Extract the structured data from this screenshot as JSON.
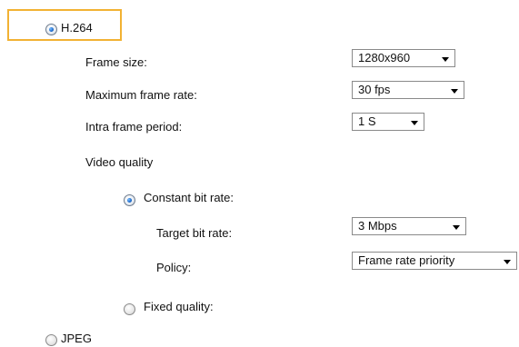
{
  "codec": {
    "h264_label": "H.264",
    "jpeg_label": "JPEG",
    "selected": "H.264"
  },
  "h264": {
    "frame_size_label": "Frame size:",
    "frame_size_value": "1280x960",
    "max_frame_rate_label": "Maximum frame rate:",
    "max_frame_rate_value": "30 fps",
    "intra_frame_period_label": "Intra frame period:",
    "intra_frame_period_value": "1 S",
    "video_quality_label": "Video quality",
    "constant_bit_rate_label": "Constant bit rate:",
    "target_bit_rate_label": "Target bit rate:",
    "target_bit_rate_value": "3 Mbps",
    "policy_label": "Policy:",
    "policy_value": "Frame rate priority",
    "fixed_quality_label": "Fixed quality:",
    "quality_mode_selected": "Constant bit rate"
  },
  "colors": {
    "highlight": "#f2b233",
    "radio_selected": "#1f6fd1"
  }
}
